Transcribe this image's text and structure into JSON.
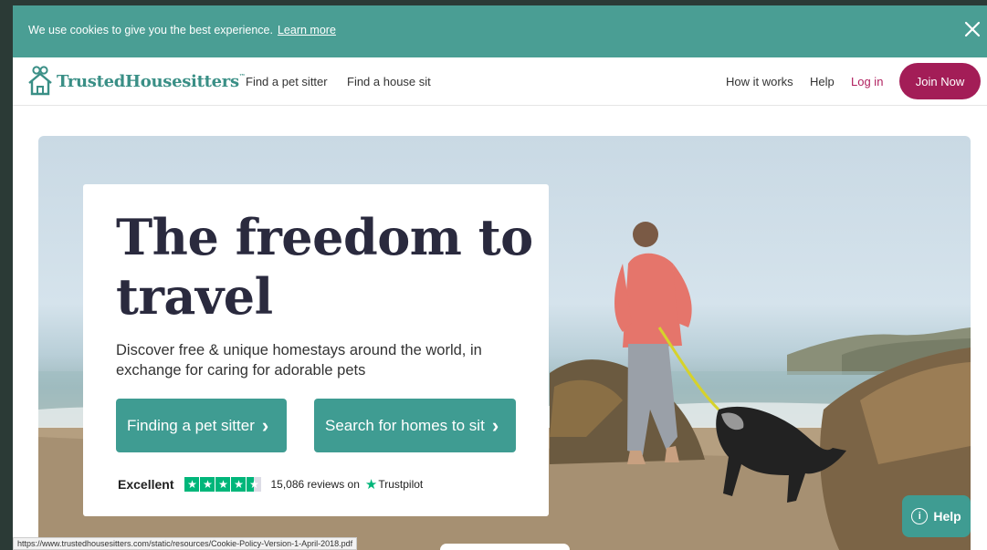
{
  "cookie_banner": {
    "text": "We use cookies to give you the best experience.",
    "link_label": "Learn more"
  },
  "nav": {
    "brand": "TrustedHousesitters",
    "brand_tm": "™",
    "links": [
      "Find a pet sitter",
      "Find a house sit"
    ],
    "right_links": [
      "How it works",
      "Help"
    ],
    "login_label": "Log in",
    "join_label": "Join Now"
  },
  "hero": {
    "headline": "The freedom to travel",
    "subtext": "Discover free & unique homestays around the world, in exchange for caring for adorable pets",
    "cta_primary": "Finding a pet sitter",
    "cta_secondary": "Search for homes to sit",
    "chevron": "›"
  },
  "trustpilot": {
    "rating_word": "Excellent",
    "stars": 4.5,
    "reviews_text": "15,086 reviews on",
    "brand": "Trustpilot"
  },
  "help_widget": {
    "label": "Help"
  },
  "status_bar": {
    "url": "https://www.trustedhousesitters.com/static/resources/Cookie-Policy-Version-1-April-2018.pdf"
  },
  "colors": {
    "teal": "#4a9e94",
    "brand_pink": "#a31d57",
    "trustpilot_green": "#00b67a"
  },
  "icons": [
    "close-icon",
    "house-logo-icon",
    "chevron-right-icon",
    "star-icon",
    "info-icon"
  ]
}
